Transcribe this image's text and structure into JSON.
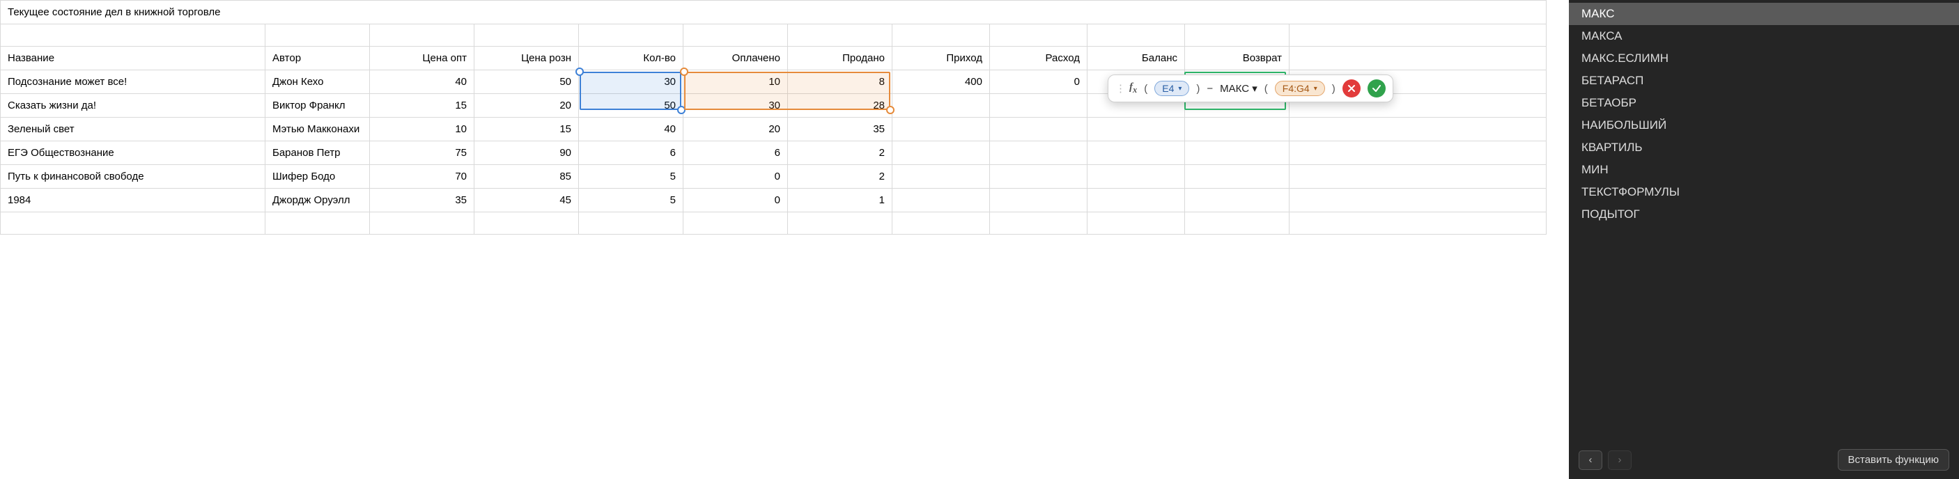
{
  "table": {
    "title": "Текущее состояние дел в книжной торговле",
    "headers": {
      "c0": "Название",
      "c1": "Автор",
      "c2": "Цена опт",
      "c3": "Цена розн",
      "c4": "Кол-во",
      "c5": "Оплачено",
      "c6": "Продано",
      "c7": "Приход",
      "c8": "Расход",
      "c9": "Баланс",
      "c10": "Возврат"
    },
    "rows": [
      {
        "c0": "Подсознание может все!",
        "c1": "Джон Кехо",
        "c2": "40",
        "c3": "50",
        "c4": "30",
        "c5": "10",
        "c6": "8",
        "c7": "400",
        "c8": "0",
        "c9": "",
        "c10": ""
      },
      {
        "c0": "Сказать жизни да!",
        "c1": "Виктор Франкл",
        "c2": "15",
        "c3": "20",
        "c4": "50",
        "c5": "30",
        "c6": "28",
        "c7": "",
        "c8": "",
        "c9": "",
        "c10": ""
      },
      {
        "c0": "Зеленый свет",
        "c1": "Мэтью Макконахи",
        "c2": "10",
        "c3": "15",
        "c4": "40",
        "c5": "20",
        "c6": "35",
        "c7": "",
        "c8": "",
        "c9": "",
        "c10": ""
      },
      {
        "c0": "ЕГЭ Обществознание",
        "c1": "Баранов Петр",
        "c2": "75",
        "c3": "90",
        "c4": "6",
        "c5": "6",
        "c6": "2",
        "c7": "",
        "c8": "",
        "c9": "",
        "c10": ""
      },
      {
        "c0": "Путь к финансовой свободе",
        "c1": "Шифер Бодо",
        "c2": "70",
        "c3": "85",
        "c4": "5",
        "c5": "0",
        "c6": "2",
        "c7": "",
        "c8": "",
        "c9": "",
        "c10": ""
      },
      {
        "c0": "1984",
        "c1": "Джордж Оруэлл",
        "c2": "35",
        "c3": "45",
        "c4": "5",
        "c5": "0",
        "c6": "1",
        "c7": "",
        "c8": "",
        "c9": "",
        "c10": ""
      }
    ]
  },
  "formula": {
    "ref1": "E4",
    "op": "−",
    "func": "МАКС",
    "ref2": "F4:G4",
    "tri": "▾"
  },
  "sidebar": {
    "items": [
      "МАКС",
      "МАКСА",
      "МАКС.ЕСЛИМН",
      "БЕТАРАСП",
      "БЕТАОБР",
      "НАИБОЛЬШИЙ",
      "КВАРТИЛЬ",
      "МИН",
      "ТЕКСТФОРМУЛЫ",
      "ПОДЫТОГ"
    ],
    "selected_index": 0,
    "nav_prev": "‹",
    "nav_next": "›",
    "insert_label": "Вставить функцию"
  }
}
